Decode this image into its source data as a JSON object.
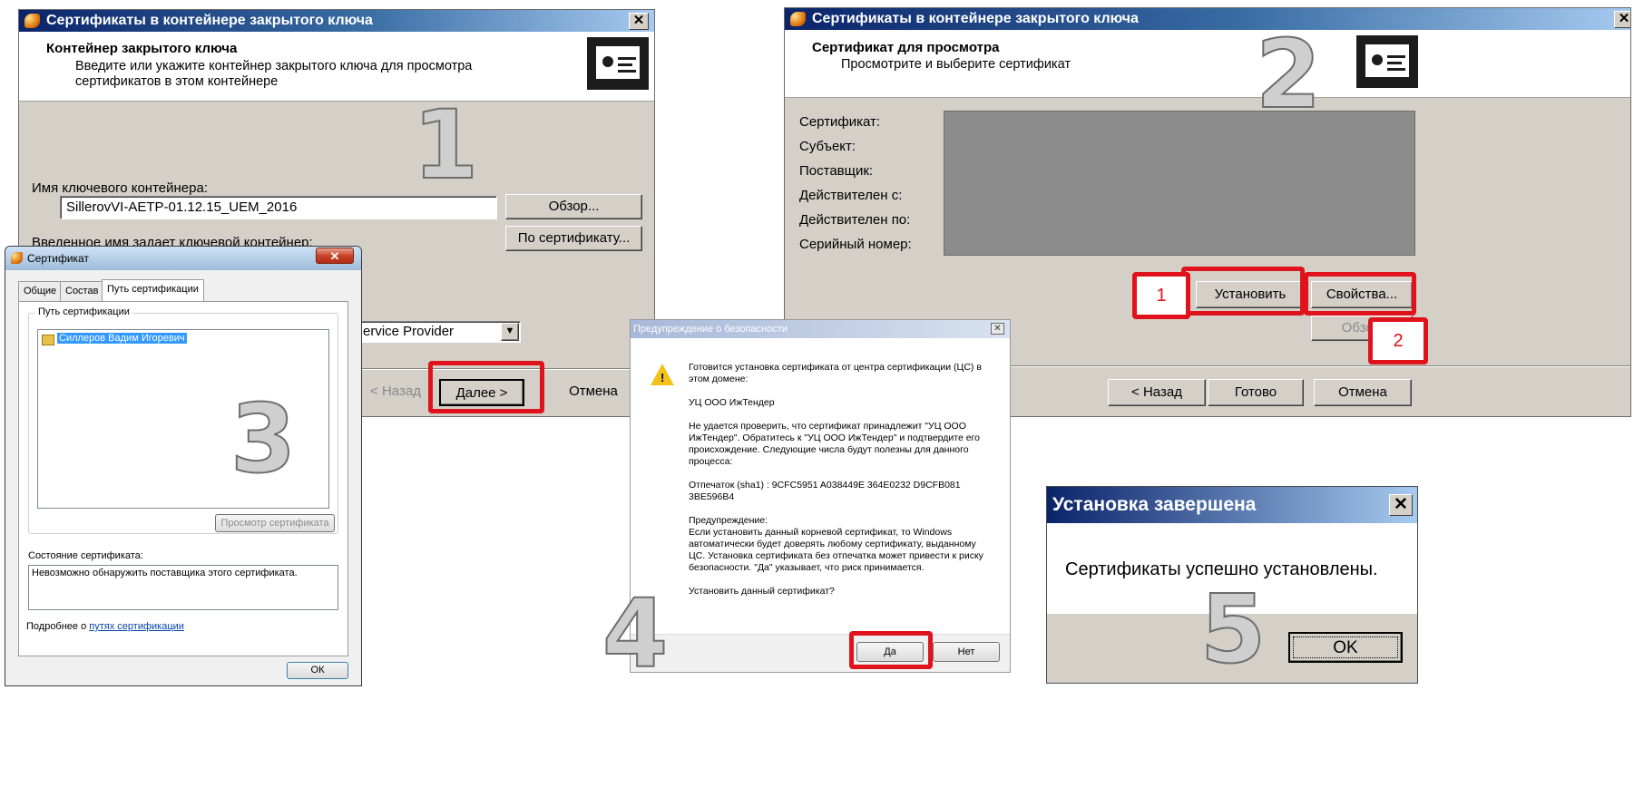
{
  "dialog1": {
    "title": "Сертификаты в контейнере закрытого ключа",
    "header_title": "Контейнер закрытого ключа",
    "header_sub": "Введите или укажите контейнер закрытого ключа для просмотра сертификатов в этом контейнере",
    "step_number": "1",
    "container_label": "Имя ключевого контейнера:",
    "container_value": "SillerovVI-AETP-01.12.15_UEM_2016",
    "browse_button": "Обзор...",
    "by_cert_button": "По сертификату...",
    "entered_name_label": "Введенное имя задает ключевой контейнер:",
    "provider_value": "ervice Provider",
    "back_button": "< Назад",
    "next_button": "Далее >",
    "cancel_button": "Отмена"
  },
  "dialog2": {
    "title": "Сертификаты в контейнере закрытого ключа",
    "header_title": "Сертификат для просмотра",
    "header_sub": "Просмотрите и выберите сертификат",
    "step_number": "2",
    "fields": [
      {
        "label": "Сертификат:"
      },
      {
        "label": "Субъект:"
      },
      {
        "label": "Поставщик:"
      },
      {
        "label": "Действителен с:"
      },
      {
        "label": "Действителен по:"
      },
      {
        "label": "Серийный номер:"
      }
    ],
    "marker1": "1",
    "marker2": "2",
    "install_button": "Установить",
    "properties_button": "Свойства...",
    "browse_button": "Обзор",
    "back_button": "< Назад",
    "done_button": "Готово",
    "cancel_button": "Отмена"
  },
  "dialog3": {
    "title": "Сертификат",
    "tabs": [
      "Общие",
      "Состав",
      "Путь сертификации"
    ],
    "path_group_label": "Путь сертификации",
    "path_item": "Силлеров Вадим Игоревич",
    "step_number": "3",
    "view_cert_button": "Просмотр сертификата",
    "status_label": "Состояние сертификата:",
    "status_text": "Невозможно обнаружить поставщика этого сертификата.",
    "more_prefix": "Подробнее о ",
    "more_link": "путях сертификации",
    "ok_button": "ОК"
  },
  "dialog4": {
    "title": "Предупреждение о безопасности",
    "step_number": "4",
    "p1": "Готовится установка сертификата от центра сертификации (ЦС) в этом домене:",
    "p2": "УЦ ООО ИжТендер",
    "p3": "Не удается проверить, что сертификат принадлежит \"УЦ ООО ИжТендер\". Обратитесь к \"УЦ ООО ИжТендер\" и подтвердите его происхождение. Следующие числа будут полезны для данного процесса:",
    "p4": "Отпечаток (sha1) : 9CFC5951 A038449E 364E0232 D9CFB081 3BE596B4",
    "p5_title": "Предупреждение:",
    "p5": "Если установить данный корневой сертификат, то Windows автоматически будет доверять любому сертификату, выданному ЦС. Установка сертификата без отпечатка может привести к риску безопасности. \"Да\" указывает, что риск принимается.",
    "p6": "Установить данный сертификат?",
    "yes_button": "Да",
    "no_button": "Нет"
  },
  "dialog5": {
    "title": "Установка завершена",
    "message": "Сертификаты успешно установлены.",
    "step_number": "5",
    "ok_button": "OK"
  }
}
